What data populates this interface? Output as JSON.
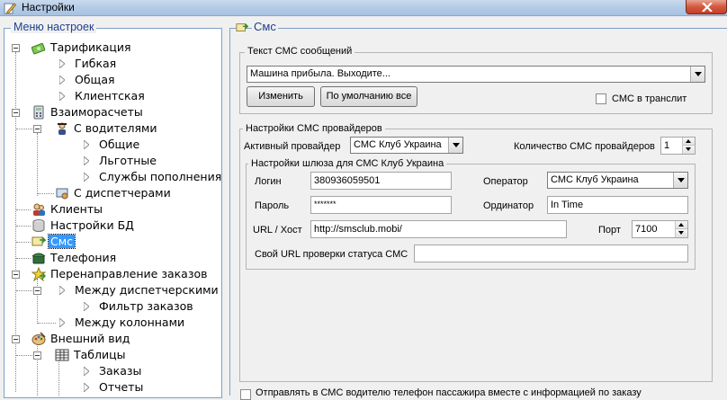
{
  "window": {
    "title": "Настройки"
  },
  "tree": {
    "legend": "Меню настроек",
    "items": [
      {
        "label": "Тарификация",
        "icon": "money-icon"
      },
      {
        "label": "Гибкая"
      },
      {
        "label": "Общая"
      },
      {
        "label": "Клиентская"
      },
      {
        "label": "Взаиморасчеты",
        "icon": "calculator-icon"
      },
      {
        "label": "С водителями",
        "icon": "driver-icon"
      },
      {
        "label": "Общие"
      },
      {
        "label": "Льготные"
      },
      {
        "label": "Службы пополнения"
      },
      {
        "label": "С диспетчерами",
        "icon": "dispatcher-icon"
      },
      {
        "label": "Клиенты",
        "icon": "clients-icon"
      },
      {
        "label": "Настройки БД",
        "icon": "database-icon"
      },
      {
        "label": "Смс",
        "icon": "sms-icon",
        "selected": true
      },
      {
        "label": "Телефония",
        "icon": "phone-icon"
      },
      {
        "label": "Перенаправление заказов",
        "icon": "redirect-icon"
      },
      {
        "label": "Между диспетчерскими"
      },
      {
        "label": "Фильтр заказов"
      },
      {
        "label": "Между колоннами"
      },
      {
        "label": "Внешний вид",
        "icon": "palette-icon"
      },
      {
        "label": "Таблицы",
        "icon": "table-icon"
      },
      {
        "label": "Заказы"
      },
      {
        "label": "Отчеты"
      }
    ]
  },
  "sms": {
    "panel_title": "Смс",
    "text_group": {
      "legend": "Текст СМС сообщений",
      "selected_message": "Машина прибыла. Выходите...",
      "edit_button": "Изменить",
      "default_button": "По умолчанию все",
      "translit_label": "СМС в транслит",
      "translit_checked": false
    },
    "providers_group": {
      "legend": "Настройки СМС провайдеров",
      "active_provider_label": "Активный провайдер",
      "active_provider_value": "СМС Клуб Украина",
      "provider_count_label": "Количество СМС провайдеров",
      "provider_count_value": "1",
      "gateway": {
        "legend": "Настройки шлюза для СМС Клуб Украина",
        "login_label": "Логин",
        "login_value": "380936059501",
        "password_label": "Пароль",
        "password_value": "*******",
        "operator_label": "Оператор",
        "operator_value": "СМС Клуб Украина",
        "originator_label": "Ординатор",
        "originator_value": "In Time",
        "url_label": "URL / Хост",
        "url_value": "http://smsclub.mobi/",
        "port_label": "Порт",
        "port_value": "7100",
        "status_url_label": "Свой URL проверки статуса СМС",
        "status_url_value": ""
      }
    },
    "send_phone_label": "Отправлять в СМС водителю телефон пассажира вместе с информацией по заказу",
    "send_phone_checked": false
  }
}
